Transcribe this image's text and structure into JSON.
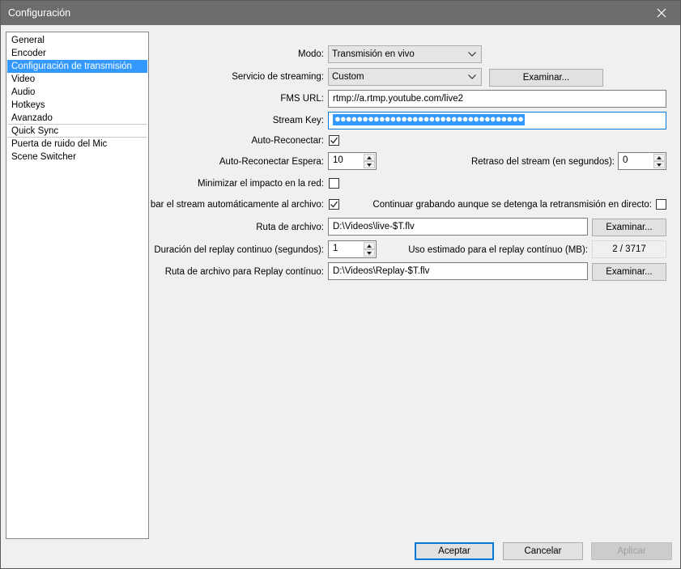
{
  "window": {
    "title": "Configuración"
  },
  "sidebar": {
    "items": [
      {
        "label": "General"
      },
      {
        "label": "Encoder"
      },
      {
        "label": "Configuración de transmisión"
      },
      {
        "label": "Video"
      },
      {
        "label": "Audio"
      },
      {
        "label": "Hotkeys"
      },
      {
        "label": "Avanzado"
      },
      {
        "label": "Quick Sync"
      },
      {
        "label": "Puerta de ruido del Mic"
      },
      {
        "label": "Scene Switcher"
      }
    ],
    "selected": "Configuración de transmisión"
  },
  "form": {
    "mode": {
      "label": "Modo:",
      "value": "Transmisión en vivo"
    },
    "service": {
      "label": "Servicio de streaming:",
      "value": "Custom",
      "browse": "Examinar..."
    },
    "fms_url": {
      "label": "FMS URL:",
      "value": "rtmp://a.rtmp.youtube.com/live2"
    },
    "stream_key": {
      "label": "Stream Key:",
      "masked": "●●●●●●●●●●●●●●●●●●●●●●●●●●●●●●●●●●"
    },
    "auto_reconnect": {
      "label": "Auto-Reconectar:",
      "checked": true
    },
    "reconnect_wait": {
      "label": "Auto-Reconectar Espera:",
      "value": "10"
    },
    "stream_delay": {
      "label": "Retraso del stream (en segundos):",
      "value": "0"
    },
    "minimize_impact": {
      "label": "Minimizar el impacto en la red:",
      "checked": false
    },
    "auto_save": {
      "label": "bar el stream automáticamente al archivo:",
      "checked": true
    },
    "keep_recording": {
      "label": "Continuar grabando aunque se detenga la retransmisión en directo:",
      "checked": false
    },
    "file_path": {
      "label": "Ruta de archivo:",
      "value": "D:\\Videos\\live-$T.flv",
      "browse": "Examinar..."
    },
    "replay_duration": {
      "label": "Duración del replay continuo (segundos):",
      "value": "1"
    },
    "replay_usage": {
      "label": "Uso estimado para el replay contínuo (MB):",
      "value": "2 / 3717"
    },
    "replay_path": {
      "label": "Ruta de archivo para Replay contínuo:",
      "value": "D:\\Videos\\Replay-$T.flv",
      "browse": "Examinar..."
    }
  },
  "footer": {
    "accept": "Aceptar",
    "cancel": "Cancelar",
    "apply": "Aplicar"
  },
  "icons": {
    "close": "close-icon",
    "dropdown": "chevron-down-icon",
    "check": "checkmark-icon",
    "spin_up": "spin-up-icon",
    "spin_down": "spin-down-icon"
  },
  "colors": {
    "titlebar": "#6d6d6d",
    "selection": "#3399ff",
    "focus_border": "#0078d7"
  }
}
